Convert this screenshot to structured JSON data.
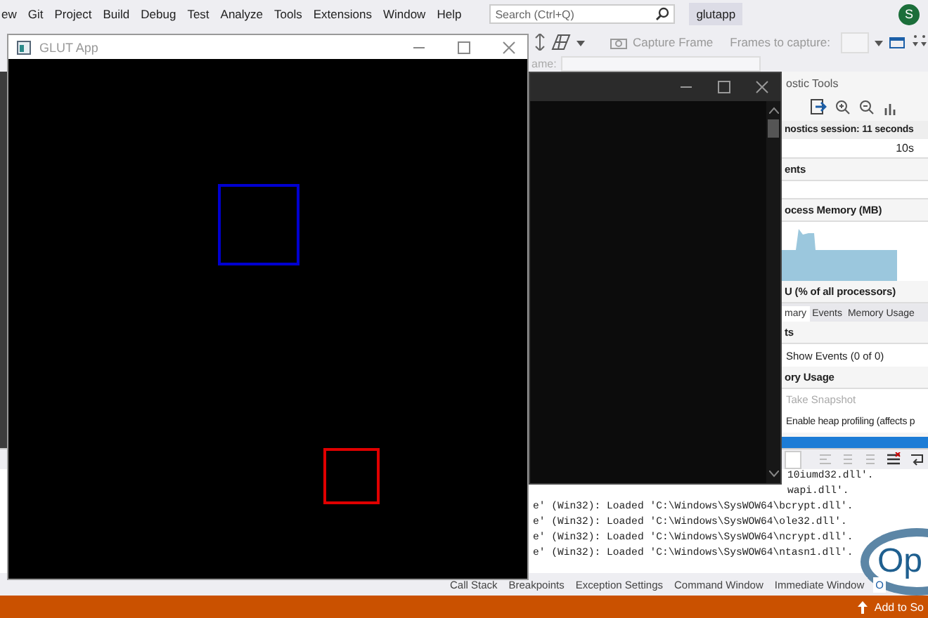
{
  "menu_bar": {
    "items": [
      "ew",
      "Git",
      "Project",
      "Build",
      "Debug",
      "Test",
      "Analyze",
      "Tools",
      "Extensions",
      "Window",
      "Help"
    ],
    "search": {
      "placeholder": "Search (Ctrl+Q)"
    },
    "solution_name": "glutapp",
    "avatar_initial": "S"
  },
  "toolbar": {
    "capture_button": "Capture Frame",
    "frames_label": "Frames to capture:"
  },
  "toolbar_2": {
    "field_label": "ame:"
  },
  "diagnostics": {
    "title": "ostic Tools",
    "session": "nostics session: 11 seconds",
    "timeline_label": "10s",
    "rows": [
      {
        "kind": "header",
        "text": "ents"
      },
      {
        "kind": "lane"
      },
      {
        "kind": "header",
        "text": "ocess Memory (MB)"
      },
      {
        "kind": "chart"
      },
      {
        "kind": "header",
        "text": "U (% of all processors)"
      },
      {
        "kind": "tabs",
        "tabs": [
          {
            "label": "mary",
            "selected": true
          },
          {
            "label": "Events",
            "selected": false
          },
          {
            "label": "Memory Usage",
            "selected": false
          }
        ]
      },
      {
        "kind": "header",
        "text": "ts"
      },
      {
        "kind": "link",
        "text": "Show Events (0 of 0)"
      },
      {
        "kind": "header",
        "text": "ory Usage"
      },
      {
        "kind": "action",
        "text": "Take Snapshot",
        "disabled": true
      },
      {
        "kind": "checkbox",
        "text": "Enable heap profiling (affects p"
      },
      {
        "kind": "bar"
      }
    ]
  },
  "output": {
    "lines": [
      "10iumd32.dll'.",
      "wapi.dll'.",
      "e' (Win32): Loaded 'C:\\Windows\\SysWOW64\\bcrypt.dll'.",
      "e' (Win32): Loaded 'C:\\Windows\\SysWOW64\\ole32.dll'.",
      "e' (Win32): Loaded 'C:\\Windows\\SysWOW64\\ncrypt.dll'.",
      "e' (Win32): Loaded 'C:\\Windows\\SysWOW64\\ntasn1.dll'."
    ]
  },
  "bottom_tabs": [
    {
      "label": "Call Stack",
      "selected": false
    },
    {
      "label": "Breakpoints",
      "selected": false
    },
    {
      "label": "Exception Settings",
      "selected": false
    },
    {
      "label": "Command Window",
      "selected": false
    },
    {
      "label": "Immediate Window",
      "selected": false
    },
    {
      "label": "O",
      "selected": true
    }
  ],
  "status_bar": {
    "action": "Add to So"
  },
  "logo": {
    "text": "Op"
  },
  "glut_window": {
    "title": "GLUT App",
    "shapes": [
      {
        "color": "#0000d0"
      },
      {
        "color": "#e00000"
      }
    ]
  }
}
